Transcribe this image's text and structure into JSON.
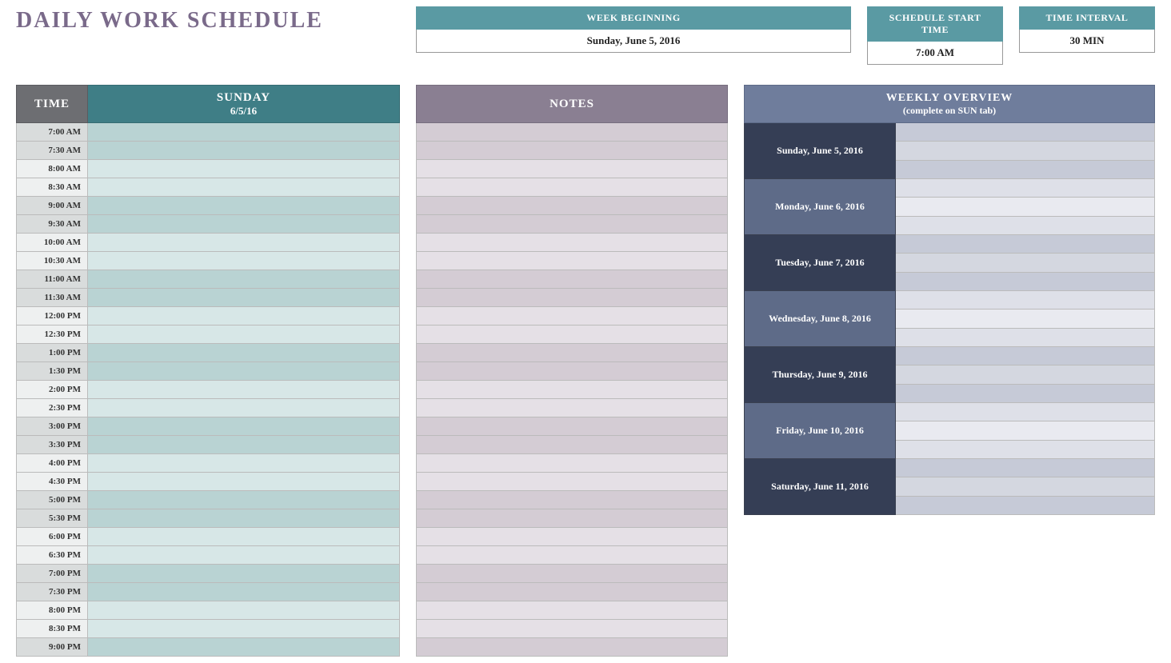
{
  "title": "DAILY WORK SCHEDULE",
  "info": {
    "week_beginning": {
      "label": "WEEK BEGINNING",
      "value": "Sunday, June 5, 2016"
    },
    "start_time": {
      "label": "SCHEDULE START TIME",
      "value": "7:00 AM"
    },
    "interval": {
      "label": "TIME INTERVAL",
      "value": "30 MIN"
    }
  },
  "schedule": {
    "time_header": "TIME",
    "day_name": "SUNDAY",
    "day_date": "6/5/16",
    "rows": [
      {
        "time": "7:00 AM",
        "value": ""
      },
      {
        "time": "7:30 AM",
        "value": ""
      },
      {
        "time": "8:00 AM",
        "value": ""
      },
      {
        "time": "8:30 AM",
        "value": ""
      },
      {
        "time": "9:00 AM",
        "value": ""
      },
      {
        "time": "9:30 AM",
        "value": ""
      },
      {
        "time": "10:00 AM",
        "value": ""
      },
      {
        "time": "10:30 AM",
        "value": ""
      },
      {
        "time": "11:00 AM",
        "value": ""
      },
      {
        "time": "11:30 AM",
        "value": ""
      },
      {
        "time": "12:00 PM",
        "value": ""
      },
      {
        "time": "12:30 PM",
        "value": ""
      },
      {
        "time": "1:00 PM",
        "value": ""
      },
      {
        "time": "1:30 PM",
        "value": ""
      },
      {
        "time": "2:00 PM",
        "value": ""
      },
      {
        "time": "2:30 PM",
        "value": ""
      },
      {
        "time": "3:00 PM",
        "value": ""
      },
      {
        "time": "3:30 PM",
        "value": ""
      },
      {
        "time": "4:00 PM",
        "value": ""
      },
      {
        "time": "4:30 PM",
        "value": ""
      },
      {
        "time": "5:00 PM",
        "value": ""
      },
      {
        "time": "5:30 PM",
        "value": ""
      },
      {
        "time": "6:00 PM",
        "value": ""
      },
      {
        "time": "6:30 PM",
        "value": ""
      },
      {
        "time": "7:00 PM",
        "value": ""
      },
      {
        "time": "7:30 PM",
        "value": ""
      },
      {
        "time": "8:00 PM",
        "value": ""
      },
      {
        "time": "8:30 PM",
        "value": ""
      },
      {
        "time": "9:00 PM",
        "value": ""
      }
    ]
  },
  "notes": {
    "header": "NOTES",
    "rows": [
      "",
      "",
      "",
      "",
      "",
      "",
      "",
      "",
      "",
      "",
      "",
      "",
      "",
      "",
      "",
      "",
      "",
      "",
      "",
      "",
      "",
      "",
      "",
      "",
      "",
      "",
      "",
      "",
      ""
    ]
  },
  "overview": {
    "header_line1": "WEEKLY OVERVIEW",
    "header_line2": "(complete on SUN tab)",
    "days": [
      "Sunday, June 5, 2016",
      "Monday, June 6, 2016",
      "Tuesday, June 7, 2016",
      "Wednesday, June 8, 2016",
      "Thursday, June 9, 2016",
      "Friday, June 10, 2016",
      "Saturday, June 11, 2016"
    ]
  }
}
